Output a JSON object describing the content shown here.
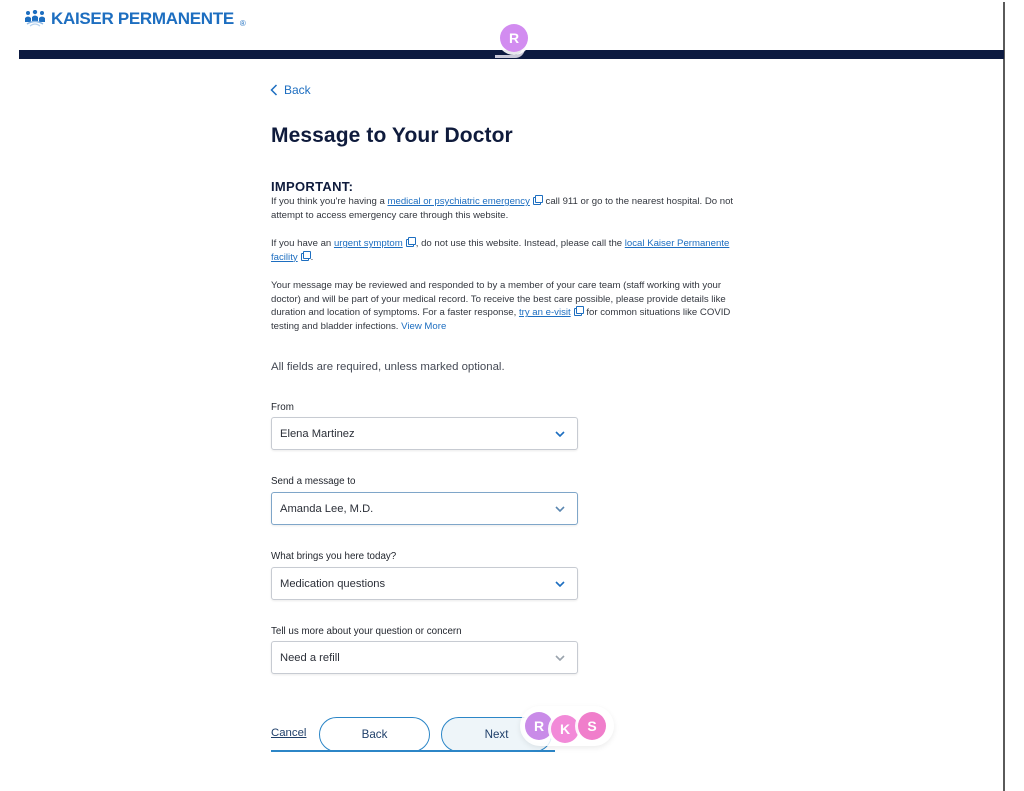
{
  "brand": {
    "name": "KAISER PERMANENTE",
    "registered_mark": "®",
    "logo_icon": "kaiser-people-icon",
    "primary_color": "#1d6ec0",
    "nav_color": "#0c1a40"
  },
  "collaborators": {
    "top": {
      "initial": "R",
      "color": "#d28cf0"
    },
    "bottom": [
      {
        "initial": "R",
        "color": "#c98be8"
      },
      {
        "initial": "K",
        "color": "#f28ad8"
      },
      {
        "initial": "S",
        "color": "#f07ecb"
      }
    ]
  },
  "nav": {
    "back_label": "Back",
    "back_icon": "chevron-left-icon"
  },
  "page": {
    "title": "Message to Your Doctor",
    "important_heading": "IMPORTANT:",
    "p1": {
      "before": "If you think you're having a ",
      "link": "medical or psychiatric emergency",
      "after": " call 911 or go to the nearest hospital. Do not attempt to access emergency care through this website."
    },
    "p2": {
      "before": "If you have an ",
      "link1": "urgent symptom",
      "middle": ", do not use this website. Instead, please call the ",
      "link2": "local Kaiser Permanente facility",
      "after": "."
    },
    "p3": {
      "before": "Your message may be reviewed and responded to by a member of your care team (staff working with your doctor) and will be part of your medical record. To receive the best care possible, please provide details like duration and location of symptoms. For a faster response, ",
      "link": "try an e-visit",
      "after": " for common situations like COVID testing and bladder infections. ",
      "view_more": "View More"
    },
    "required_note": "All fields are required, unless marked optional."
  },
  "form": {
    "fields": [
      {
        "label": "From",
        "value": "Elena Martinez"
      },
      {
        "label": "Send a message to",
        "value": "Amanda Lee, M.D."
      },
      {
        "label": "What brings you here today?",
        "value": "Medication questions"
      },
      {
        "label": "Tell us more about your question or concern",
        "value": "Need a refill"
      }
    ],
    "cancel_label": "Cancel",
    "back_label": "Back",
    "next_label": "Next"
  }
}
